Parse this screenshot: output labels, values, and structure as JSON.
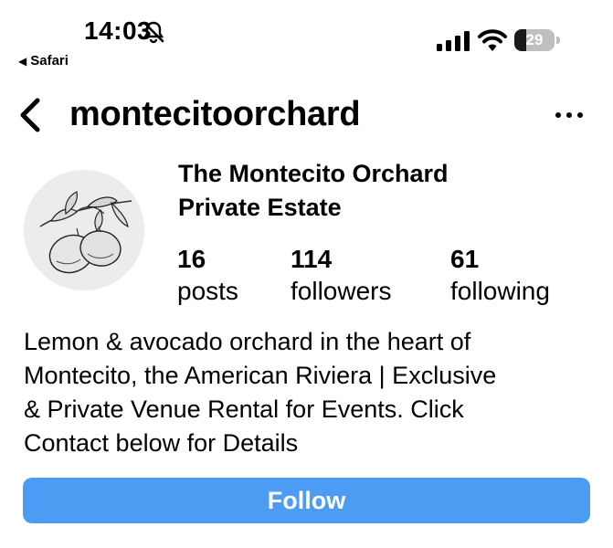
{
  "status_bar": {
    "time": "14:03",
    "back_app": "Safari",
    "battery_level": "29",
    "battery_fraction": 0.29,
    "icons": [
      "bell-slash-icon",
      "cellular-signal-icon",
      "wifi-icon",
      "battery-icon"
    ]
  },
  "header": {
    "username": "montecitoorchard",
    "icons": [
      "chevron-left-icon",
      "more-icon"
    ]
  },
  "profile": {
    "avatar": "lemon-illustration",
    "display_name_line1": "The Montecito Orchard",
    "display_name_line2": "Private Estate",
    "stats": [
      {
        "count": "16",
        "label": "posts"
      },
      {
        "count": "114",
        "label": "followers"
      },
      {
        "count": "61",
        "label": "following"
      }
    ],
    "bio_lines": [
      "Lemon & avocado orchard in the heart of",
      "Montecito, the American Riviera | Exclusive",
      "& Private Venue Rental for Events. Click",
      "Contact below for Details"
    ]
  },
  "actions": {
    "follow_label": "Follow",
    "follow_color": "#4d9cf4"
  }
}
